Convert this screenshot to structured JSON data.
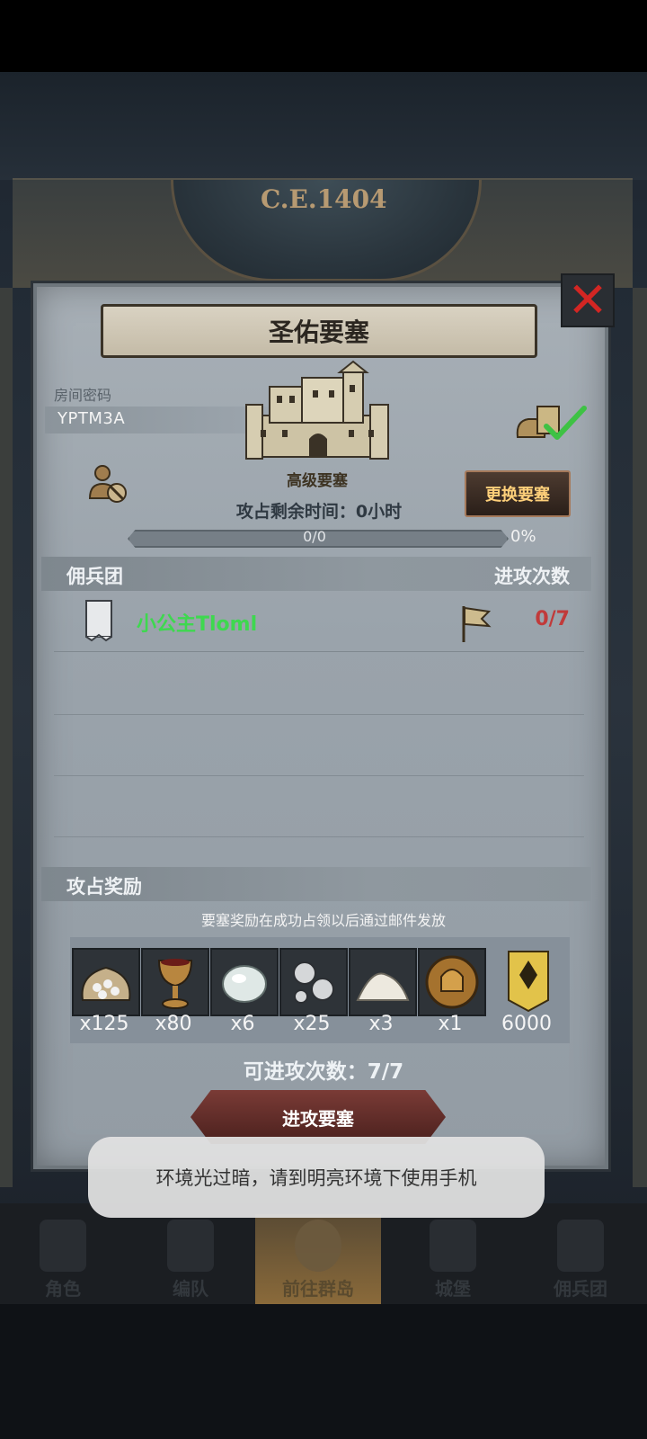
{
  "era": "C.E.1404",
  "title": "圣佑要塞",
  "room_code": {
    "label": "房间密码",
    "value": "YPTM3A"
  },
  "fortress": {
    "type": "高级要塞",
    "time_left_label": "攻占剩余时间：",
    "time_left_value": "0",
    "time_left_unit": "小时",
    "change_button": "更换要塞",
    "progress_text": "0/0",
    "progress_pct": "0%",
    "progress_fraction": 0
  },
  "mercenary_section": {
    "header": "佣兵团",
    "right_header": "进攻次数",
    "rows": [
      {
        "name": "小公主Tloml",
        "attacks": "0/7"
      }
    ]
  },
  "reward_section": {
    "header": "攻占奖励",
    "note": "要塞奖励在成功占领以后通过邮件发放",
    "items": [
      {
        "icon": "silver-ore-bag-icon",
        "qty": "x125"
      },
      {
        "icon": "goblet-icon",
        "qty": "x80"
      },
      {
        "icon": "white-gem-icon",
        "qty": "x6"
      },
      {
        "icon": "silver-beads-icon",
        "qty": "x25"
      },
      {
        "icon": "white-powder-icon",
        "qty": "x3"
      },
      {
        "icon": "helmet-medal-icon",
        "qty": "x1"
      },
      {
        "icon": "rank-badge-icon",
        "qty": "6000"
      }
    ]
  },
  "attacks_available": "可进攻次数：7/7",
  "attack_button": "进攻要塞",
  "toast": "环境光过暗，请到明亮环境下使用手机",
  "bottom_nav": [
    {
      "label": "角色",
      "icon": "knight-icon"
    },
    {
      "label": "编队",
      "icon": "helmet-icon"
    },
    {
      "label": "前往群岛",
      "icon": "globe-icon",
      "active": true
    },
    {
      "label": "城堡",
      "icon": "castle-icon"
    },
    {
      "label": "佣兵团",
      "icon": "ship-icon"
    }
  ]
}
